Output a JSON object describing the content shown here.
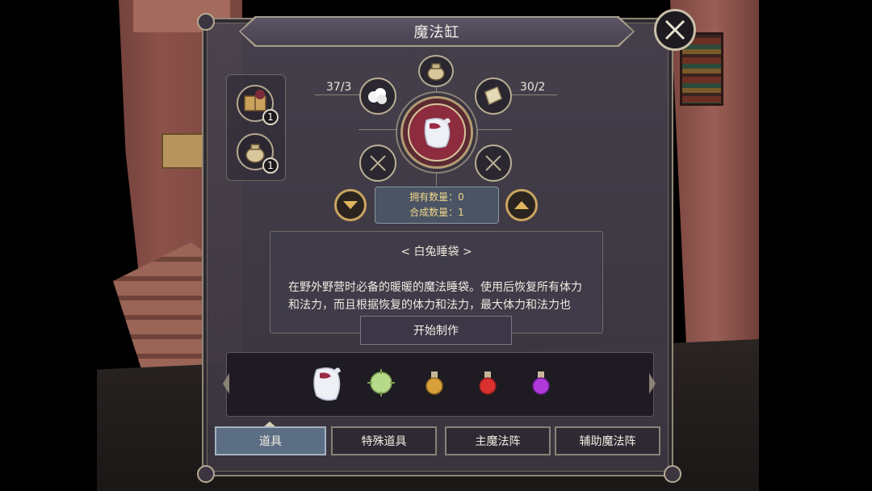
{
  "window": {
    "title": "魔法缸"
  },
  "queue": [
    {
      "icon": "spellbook-icon",
      "count": "1"
    },
    {
      "icon": "pouch-icon",
      "count": "1"
    }
  ],
  "recipe": {
    "left_count": "37/3",
    "right_count": "30/2",
    "left_ingredient": "cotton-icon",
    "top_ingredient": "pouch-icon",
    "right_ingredient": "parchment-icon",
    "center_item": "white-rabbit-sleeping-bag-icon",
    "owned_label": "拥有数量：0",
    "craft_label": "合成数量：1"
  },
  "item": {
    "name": "< 白兔睡袋 >",
    "description": "在野外野营时必备的暖暖的魔法睡袋。使用后恢复所有体力和法力，而且根据恢复的体力和法力，最大体力和法力也"
  },
  "start_button": "开始制作",
  "items_strip": [
    {
      "icon": "white-rabbit-sleeping-bag-icon"
    },
    {
      "icon": "green-spiky-fruit-icon"
    },
    {
      "icon": "yellow-potion-icon"
    },
    {
      "icon": "red-potion-icon"
    },
    {
      "icon": "purple-potion-icon"
    }
  ],
  "tabs": [
    {
      "label": "道具",
      "active": true
    },
    {
      "label": "特殊道具",
      "active": false
    },
    {
      "label": "主魔法阵",
      "active": false
    },
    {
      "label": "辅助魔法阵",
      "active": false
    }
  ],
  "colors": {
    "accent_gold": "#c9a560",
    "qty_text": "#f0d68b",
    "active_tab": "#5c6e84"
  }
}
